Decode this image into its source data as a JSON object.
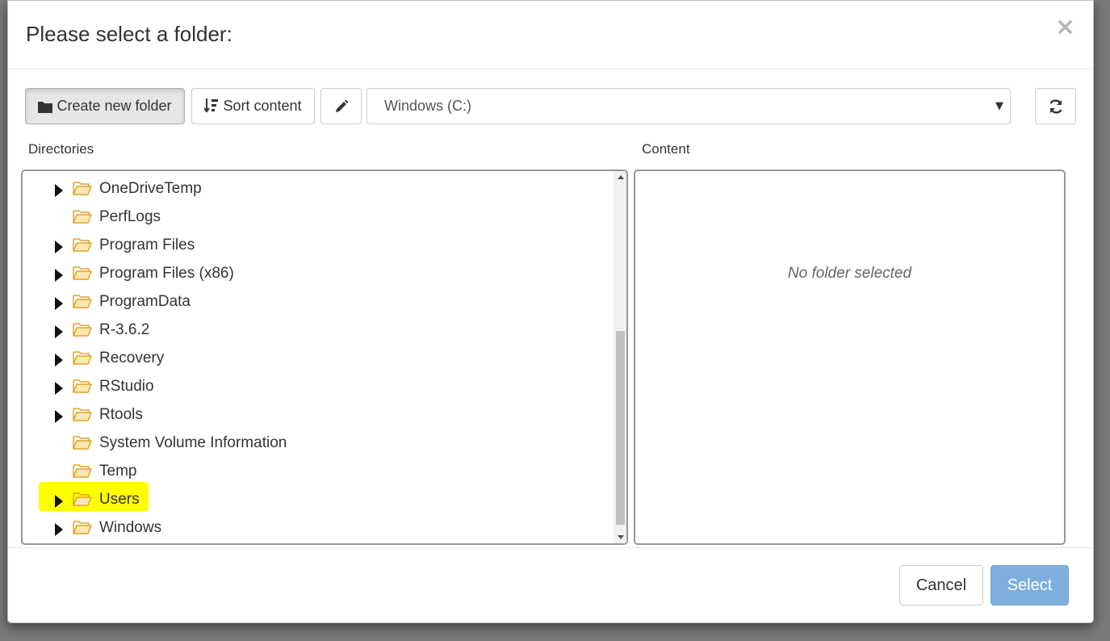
{
  "dialog": {
    "title": "Please select a folder:",
    "close_symbol": "×"
  },
  "toolbar": {
    "create_folder_label": "Create new folder",
    "sort_label": "Sort content",
    "edit_icon": "pencil-icon",
    "refresh_icon": "refresh-icon",
    "drive_select": {
      "selected": "Windows (C:)"
    }
  },
  "panels": {
    "directories_label": "Directories",
    "content_label": "Content",
    "content_empty_message": "No folder selected"
  },
  "directories": [
    {
      "name": "OneDriveTemp",
      "expandable": true
    },
    {
      "name": "PerfLogs",
      "expandable": false
    },
    {
      "name": "Program Files",
      "expandable": true
    },
    {
      "name": "Program Files (x86)",
      "expandable": true
    },
    {
      "name": "ProgramData",
      "expandable": true
    },
    {
      "name": "R-3.6.2",
      "expandable": true
    },
    {
      "name": "Recovery",
      "expandable": true
    },
    {
      "name": "RStudio",
      "expandable": true
    },
    {
      "name": "Rtools",
      "expandable": true
    },
    {
      "name": "System Volume Information",
      "expandable": false
    },
    {
      "name": "Temp",
      "expandable": false
    },
    {
      "name": "Users",
      "expandable": true,
      "highlighted": true
    },
    {
      "name": "Windows",
      "expandable": true
    }
  ],
  "footer": {
    "cancel_label": "Cancel",
    "select_label": "Select"
  },
  "colors": {
    "highlight": "#ffff00",
    "folder_fill": "#fce8b2",
    "folder_stroke": "#e0a428",
    "primary_disabled": "#7eafdc"
  }
}
